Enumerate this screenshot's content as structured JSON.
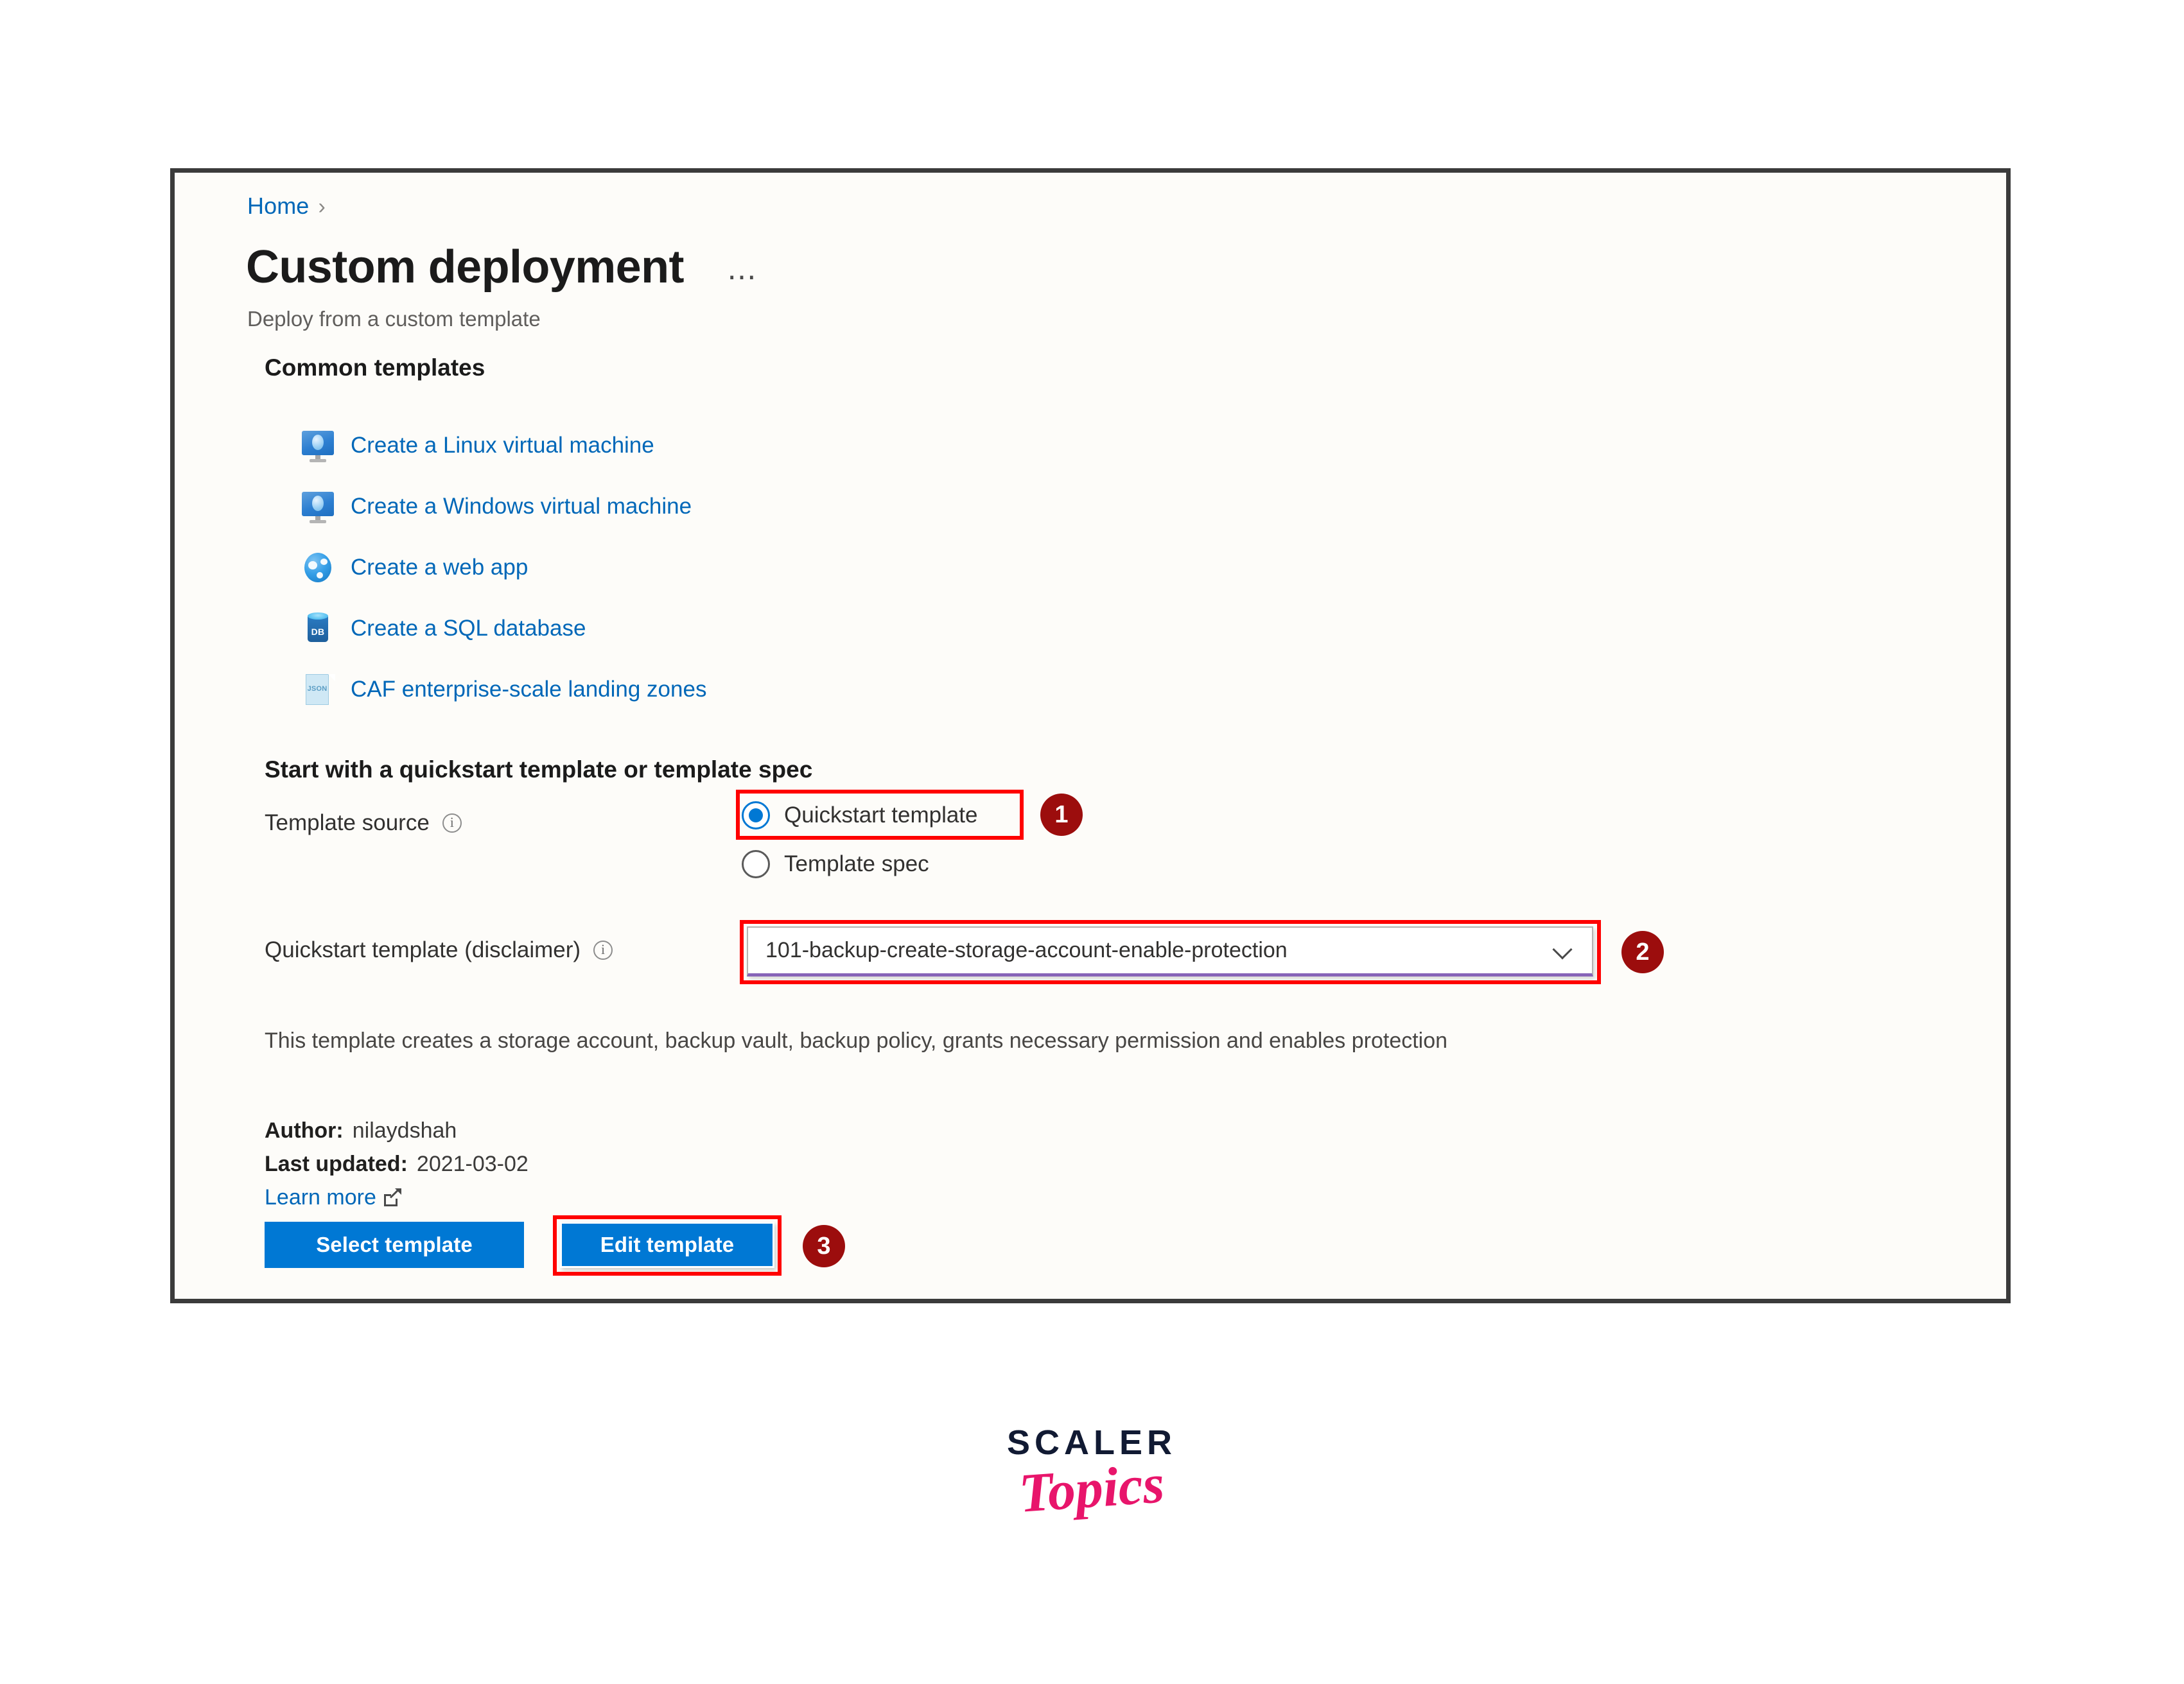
{
  "panel": {
    "breadcrumb": {
      "home": "Home",
      "separator": "›"
    },
    "title": "Custom deployment",
    "ellipsis": "⋯",
    "subtitle": "Deploy from a custom template",
    "common_templates": {
      "heading": "Common templates",
      "items": [
        {
          "icon": "linux-vm-icon",
          "label": "Create a Linux virtual machine"
        },
        {
          "icon": "windows-vm-icon",
          "label": "Create a Windows virtual machine"
        },
        {
          "icon": "web-app-icon",
          "label": "Create a web app"
        },
        {
          "icon": "sql-database-icon",
          "label": "Create a SQL database",
          "icon_text": "DB"
        },
        {
          "icon": "json-file-icon",
          "label": "CAF enterprise-scale landing zones",
          "icon_text": "JSON"
        }
      ]
    },
    "quickstart": {
      "heading": "Start with a quickstart template or template spec",
      "template_source_label": "Template source",
      "radio_options": [
        {
          "label": "Quickstart template",
          "selected": true
        },
        {
          "label": "Template spec",
          "selected": false
        }
      ],
      "quickstart_template_label": "Quickstart template (disclaimer)",
      "dropdown_value": "101-backup-create-storage-account-enable-protection",
      "description": "This template creates a storage account, backup vault, backup policy, grants necessary permission and enables protection",
      "author_key": "Author:",
      "author_value": "nilaydshah",
      "last_updated_key": "Last updated:",
      "last_updated_value": "2021-03-02",
      "learn_more": "Learn more",
      "select_template_button": "Select template",
      "edit_template_button": "Edit template"
    }
  },
  "annotations": {
    "badges": [
      {
        "number": "1",
        "target": "quickstart-template-radio"
      },
      {
        "number": "2",
        "target": "quickstart-template-dropdown"
      },
      {
        "number": "3",
        "target": "edit-template-button"
      }
    ],
    "highlight_color": "#ff0000",
    "badge_color": "#9c0d0d"
  },
  "branding": {
    "scaler": "SCALER",
    "topics": "Topics",
    "scaler_color": "#111a33",
    "topics_color": "#e8156b"
  },
  "colors": {
    "accent_blue": "#0078d4",
    "link_blue": "#0067b8",
    "panel_bg": "#fdfcf9",
    "panel_border": "#3b3b3b",
    "focus_purple": "#8764b8"
  }
}
